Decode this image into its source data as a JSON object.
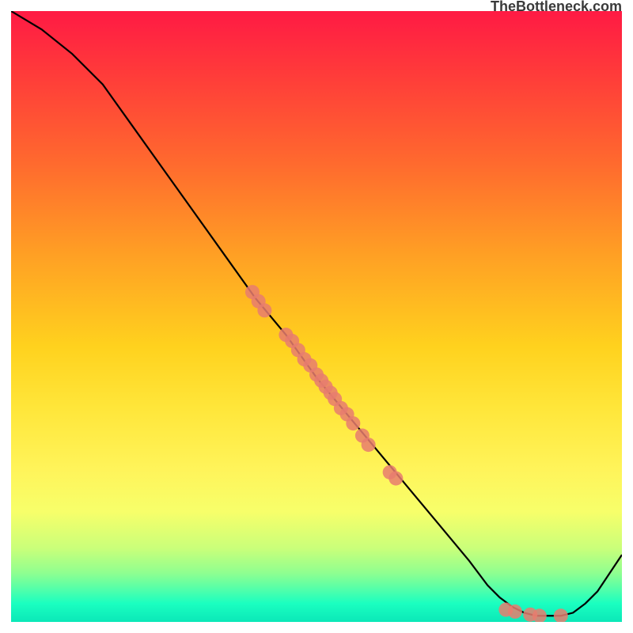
{
  "attribution": "TheBottleneck.com",
  "chart_data": {
    "type": "line",
    "title": "",
    "xlabel": "",
    "ylabel": "",
    "xlim": [
      0,
      100
    ],
    "ylim": [
      0,
      100
    ],
    "grid": false,
    "series": [
      {
        "name": "curve",
        "x": [
          0,
          5,
          10,
          15,
          20,
          25,
          30,
          35,
          40,
          45,
          50,
          55,
          60,
          65,
          70,
          75,
          78,
          80,
          82,
          84,
          86,
          88,
          90,
          92,
          94,
          96,
          100
        ],
        "y": [
          100,
          97,
          93,
          88,
          81,
          74,
          67,
          60,
          53,
          47,
          40,
          34,
          28,
          22,
          16,
          10,
          6,
          4,
          2.5,
          1.5,
          1,
          1,
          1,
          1.5,
          3,
          5,
          11
        ]
      }
    ],
    "scatter_points": {
      "name": "markers",
      "color": "#e87c6f",
      "points": [
        {
          "x": 39.5,
          "y": 54
        },
        {
          "x": 40.5,
          "y": 52.5
        },
        {
          "x": 41.5,
          "y": 51
        },
        {
          "x": 45,
          "y": 47
        },
        {
          "x": 46,
          "y": 46
        },
        {
          "x": 47,
          "y": 44.5
        },
        {
          "x": 48,
          "y": 43
        },
        {
          "x": 49,
          "y": 42
        },
        {
          "x": 50,
          "y": 40.5
        },
        {
          "x": 50.8,
          "y": 39.5
        },
        {
          "x": 51.5,
          "y": 38.5
        },
        {
          "x": 52.3,
          "y": 37.5
        },
        {
          "x": 53,
          "y": 36.5
        },
        {
          "x": 54,
          "y": 35
        },
        {
          "x": 55,
          "y": 34
        },
        {
          "x": 56,
          "y": 32.5
        },
        {
          "x": 57.5,
          "y": 30.5
        },
        {
          "x": 58.5,
          "y": 29
        },
        {
          "x": 62,
          "y": 24.5
        },
        {
          "x": 63,
          "y": 23.5
        },
        {
          "x": 81,
          "y": 2
        },
        {
          "x": 82.5,
          "y": 1.7
        },
        {
          "x": 85,
          "y": 1.2
        },
        {
          "x": 86.5,
          "y": 1
        },
        {
          "x": 90,
          "y": 1
        }
      ]
    }
  }
}
